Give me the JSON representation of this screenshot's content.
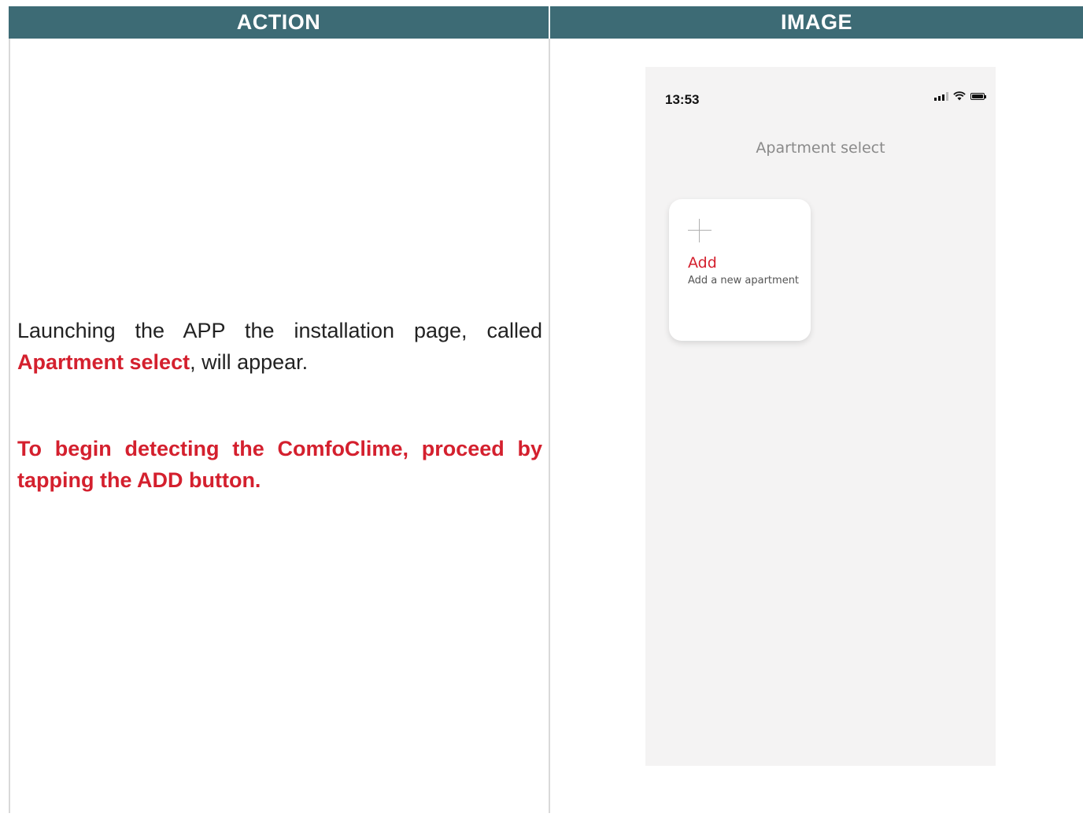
{
  "table": {
    "header_action": "ACTION",
    "header_image": "IMAGE",
    "header_color": "#3d6b75"
  },
  "instructions": {
    "line1_before": "Launching the APP the installation page, called ",
    "line1_highlight": "Apartment select",
    "line1_after": ", will appear.",
    "cta": "To begin detecting the ComfoClime, proceed by tapping the ADD button.",
    "highlight_color": "#d4202e"
  },
  "phone": {
    "status_time": "13:53",
    "status_icons": [
      "signal-icon",
      "wifi-icon",
      "battery-icon"
    ],
    "screen_title": "Apartment select",
    "add_card": {
      "icon": "plus-icon",
      "label": "Add",
      "subtitle": "Add a new apartment"
    }
  }
}
